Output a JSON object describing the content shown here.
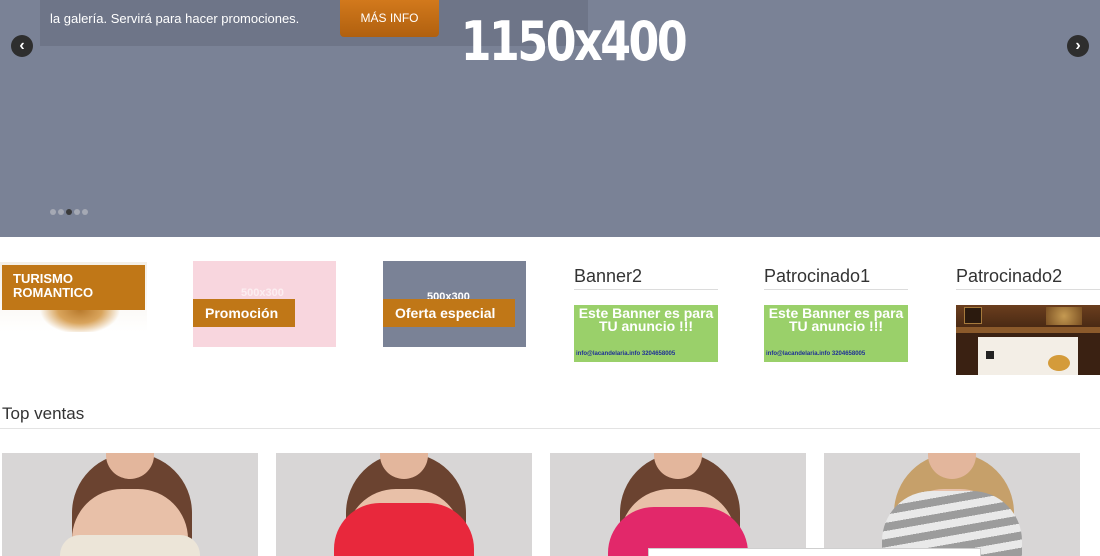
{
  "slider": {
    "caption": "la galería. Servirá para hacer promociones.",
    "more_button": "MÁS INFO",
    "slide_text": "1150x400",
    "prev_arrow": "‹",
    "next_arrow": "›",
    "dots_count": 5,
    "active_dot": 3
  },
  "banners": {
    "turismo": "TURISMO ROMANTICO",
    "promocion": "Promoción",
    "promocion_ghost": "500x300",
    "oferta": "Oferta especial",
    "oferta_ghost": "500x300"
  },
  "widgets": [
    {
      "title": "Banner2",
      "ad_text": "Este Banner es para TU anuncio !!!",
      "ad_contact": "info@lacandelaria.info 3204658005"
    },
    {
      "title": "Patrocinado1",
      "ad_text": "Este Banner es para TU anuncio !!!",
      "ad_contact": "info@lacandelaria.info 3204658005"
    },
    {
      "title": "Patrocinado2"
    }
  ],
  "top_sales": {
    "title": "Top ventas"
  },
  "colors": {
    "slider_bg": "#7a8296",
    "accent_orange": "#c07717",
    "ad_green": "#9ad06a",
    "promo_pink": "#f8d6de"
  }
}
